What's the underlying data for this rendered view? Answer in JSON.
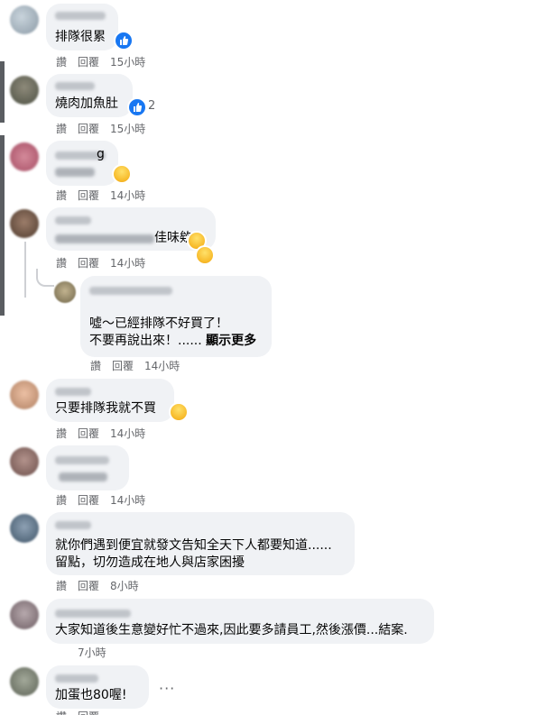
{
  "actions": {
    "like": "讚",
    "reply": "回覆"
  },
  "comments": [
    {
      "text": "排隊很累",
      "time": "15小時",
      "reaction": "like"
    },
    {
      "text": "燒肉加魚肚",
      "time": "15小時",
      "reaction": "like",
      "reaction_count": "2"
    },
    {
      "text_suffix": "g",
      "time": "14小時",
      "reaction": "haha"
    },
    {
      "text_suffix": "佳味欸",
      "time": "14小時",
      "reactions": [
        "haha",
        "wow"
      ]
    },
    {
      "line1": "噓～已經排隊不好買了！",
      "line2": "不要再說出來！......",
      "more": "顯示更多",
      "time": "14小時"
    },
    {
      "text": "只要排隊我就不買",
      "time": "14小時",
      "reaction": "haha"
    },
    {
      "time": "14小時"
    },
    {
      "line1": "就你們遇到便宜就發文告知全天下人都要知道......",
      "line2": "留點，切勿造成在地人與店家困擾",
      "time": "8小時"
    },
    {
      "text": "大家知道後生意變好忙不過來,因此要多請員工,然後漲價...結案.",
      "time": "7小時"
    },
    {
      "text": "加蛋也80喔!",
      "more_options": "···"
    }
  ],
  "colors": {
    "bubble": "#f0f2f5",
    "meta": "#65676b",
    "like_blue": "#1877f2"
  }
}
